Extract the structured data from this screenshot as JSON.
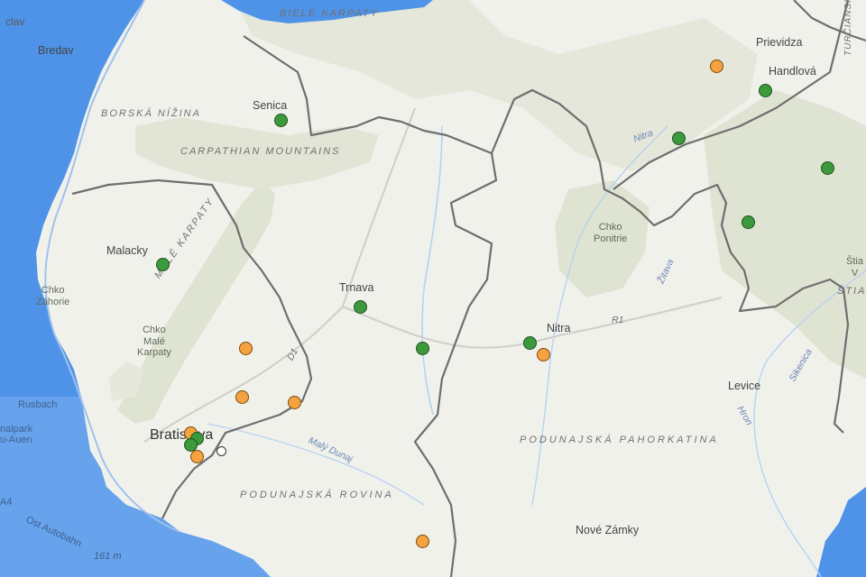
{
  "colors": {
    "water": "#4f93e8",
    "land": "#f1f1ec",
    "highland": "#dfe3d2",
    "border": "#6e6e6e",
    "active_marker": "#3c9a3c",
    "pending_marker": "#f5a340",
    "other_marker": "#ffffff"
  },
  "labels": {
    "bredav": "Bredav",
    "clav": "clav",
    "senica": "Senica",
    "borska_nizina": "BORSKÁ NÍŽINA",
    "carpathian": "CARPATHIAN MOUNTAINS",
    "male_karpaty": "MALÉ KARPATY",
    "malacky": "Malacky",
    "chko_zahorie": "Chko\nZáhorie",
    "chko_male_karpaty": "Chko\nMalé\nKarpaty",
    "trnava": "Trnava",
    "bratislava": "Bratislava",
    "podunajska_rovina": "PODUNAJSKÁ ROVINA",
    "maly_dunaj": "Malý Dunaj",
    "rusbach": "Rusbach",
    "nalpark": "nalpark\nu-Auen",
    "a4": "A4",
    "ost_autobahn": "Ost Autobahn",
    "elev_161": "161 m",
    "nitra": "Nitra",
    "r1": "R1",
    "chko_ponitrie": "Chko\nPonitrie",
    "zitava": "Žitava",
    "nitra_river": "Nitra",
    "podunajska_pahorkatina": "PODUNAJSKÁ PAHORKATINA",
    "levice": "Levice",
    "hron": "Hron",
    "sikenica": "Sikenica",
    "nove_zamky": "Nové Zámky",
    "prievidza": "Prievidza",
    "handlova": "Handlová",
    "turciansk": "TURČIANSK",
    "stia_v": "Štia\nV",
    "stiav": "ŠTIAV",
    "d1": "D1",
    "bielekarpaty": "BIELE KARPATY"
  },
  "markers": [
    {
      "id": "senica",
      "status": "active",
      "lon": 17.36,
      "lat": 48.68
    },
    {
      "id": "malacky",
      "status": "active",
      "lon": 17.02,
      "lat": 48.44
    },
    {
      "id": "trnava",
      "status": "active",
      "lon": 17.59,
      "lat": 48.37
    },
    {
      "id": "trnava-se",
      "status": "active",
      "lon": 17.77,
      "lat": 48.3
    },
    {
      "id": "nitra",
      "status": "active",
      "lon": 18.08,
      "lat": 48.31
    },
    {
      "id": "nitra-se",
      "status": "pending",
      "lon": 18.12,
      "lat": 48.29
    },
    {
      "id": "male-karpaty-se",
      "status": "pending",
      "lon": 17.26,
      "lat": 48.3
    },
    {
      "id": "pezinok",
      "status": "pending",
      "lon": 17.25,
      "lat": 48.22
    },
    {
      "id": "senec",
      "status": "pending",
      "lon": 17.4,
      "lat": 48.21
    },
    {
      "id": "bratislava-n",
      "status": "pending",
      "lon": 17.1,
      "lat": 48.16
    },
    {
      "id": "bratislava-1",
      "status": "active",
      "lon": 17.12,
      "lat": 48.15
    },
    {
      "id": "bratislava-2",
      "status": "active",
      "lon": 17.1,
      "lat": 48.14
    },
    {
      "id": "bratislava-s",
      "status": "pending",
      "lon": 17.12,
      "lat": 48.12
    },
    {
      "id": "bratislava-center",
      "status": "other",
      "lon": 17.19,
      "lat": 48.13
    },
    {
      "id": "dunajska-streda",
      "status": "pending",
      "lon": 17.77,
      "lat": 47.98
    },
    {
      "id": "prievidza",
      "status": "pending",
      "lon": 18.62,
      "lat": 48.77
    },
    {
      "id": "handlova",
      "status": "active",
      "lon": 18.76,
      "lat": 48.73
    },
    {
      "id": "nitra-valley",
      "status": "active",
      "lon": 18.51,
      "lat": 48.65
    },
    {
      "id": "east-1",
      "status": "active",
      "lon": 18.94,
      "lat": 48.6
    },
    {
      "id": "east-2",
      "status": "active",
      "lon": 18.71,
      "lat": 48.51
    }
  ]
}
